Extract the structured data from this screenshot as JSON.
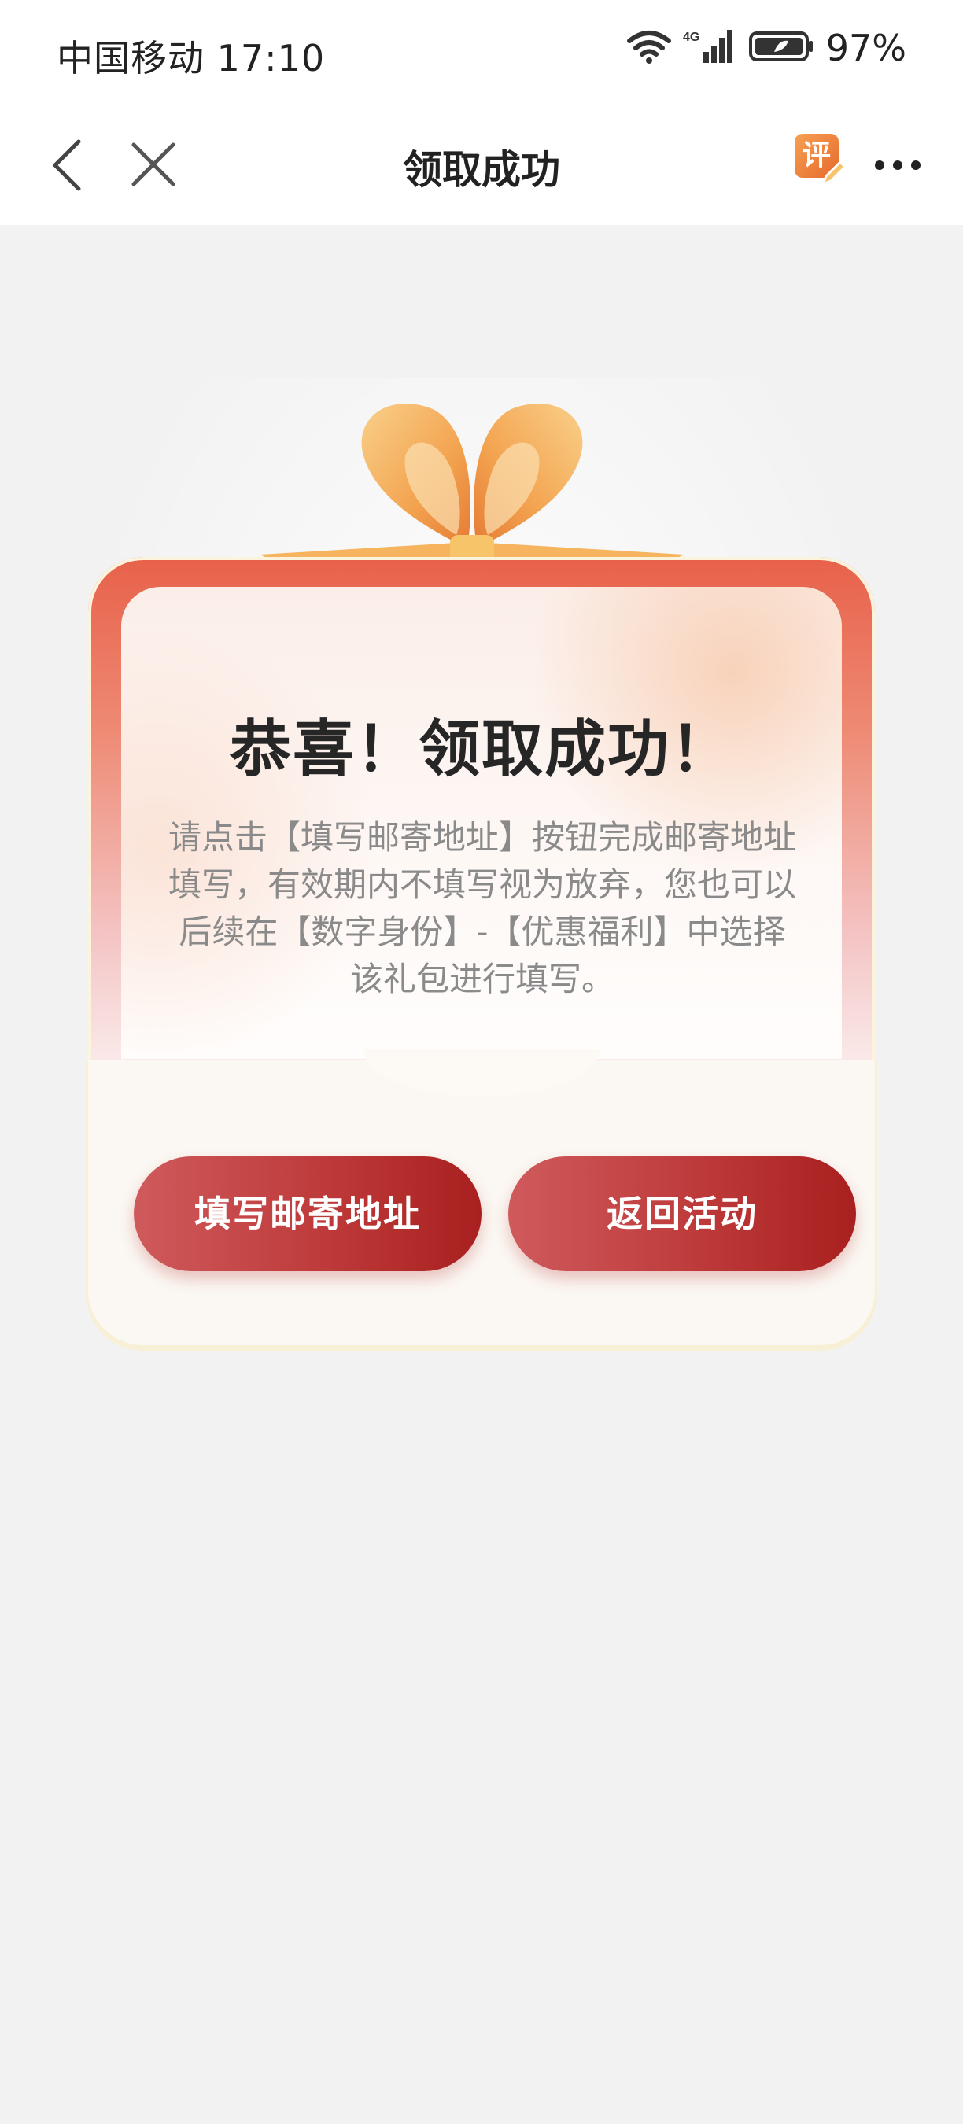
{
  "status_bar": {
    "carrier_time": "中国移动 17:10",
    "battery": "97%",
    "network": "4G",
    "icons": [
      "wifi-icon",
      "signal-icon",
      "battery-icon"
    ]
  },
  "nav": {
    "title": "领取成功",
    "back_icon": "chevron-left-icon",
    "close_icon": "close-icon",
    "rate_label": "评",
    "more_icon": "more-dots-icon"
  },
  "card": {
    "title": "恭喜！领取成功！",
    "description": "请点击【填写邮寄地址】按钮完成邮寄地址填写，有效期内不填写视为放弃，您也可以后续在【数字身份】-【优惠福利】中选择该礼包进行填写。",
    "buttons": {
      "address": "填写邮寄地址",
      "return": "返回活动"
    }
  },
  "colors": {
    "accent": "#be3a3a",
    "ribbon": "#f3a34f",
    "background": "#f2f2f2"
  }
}
